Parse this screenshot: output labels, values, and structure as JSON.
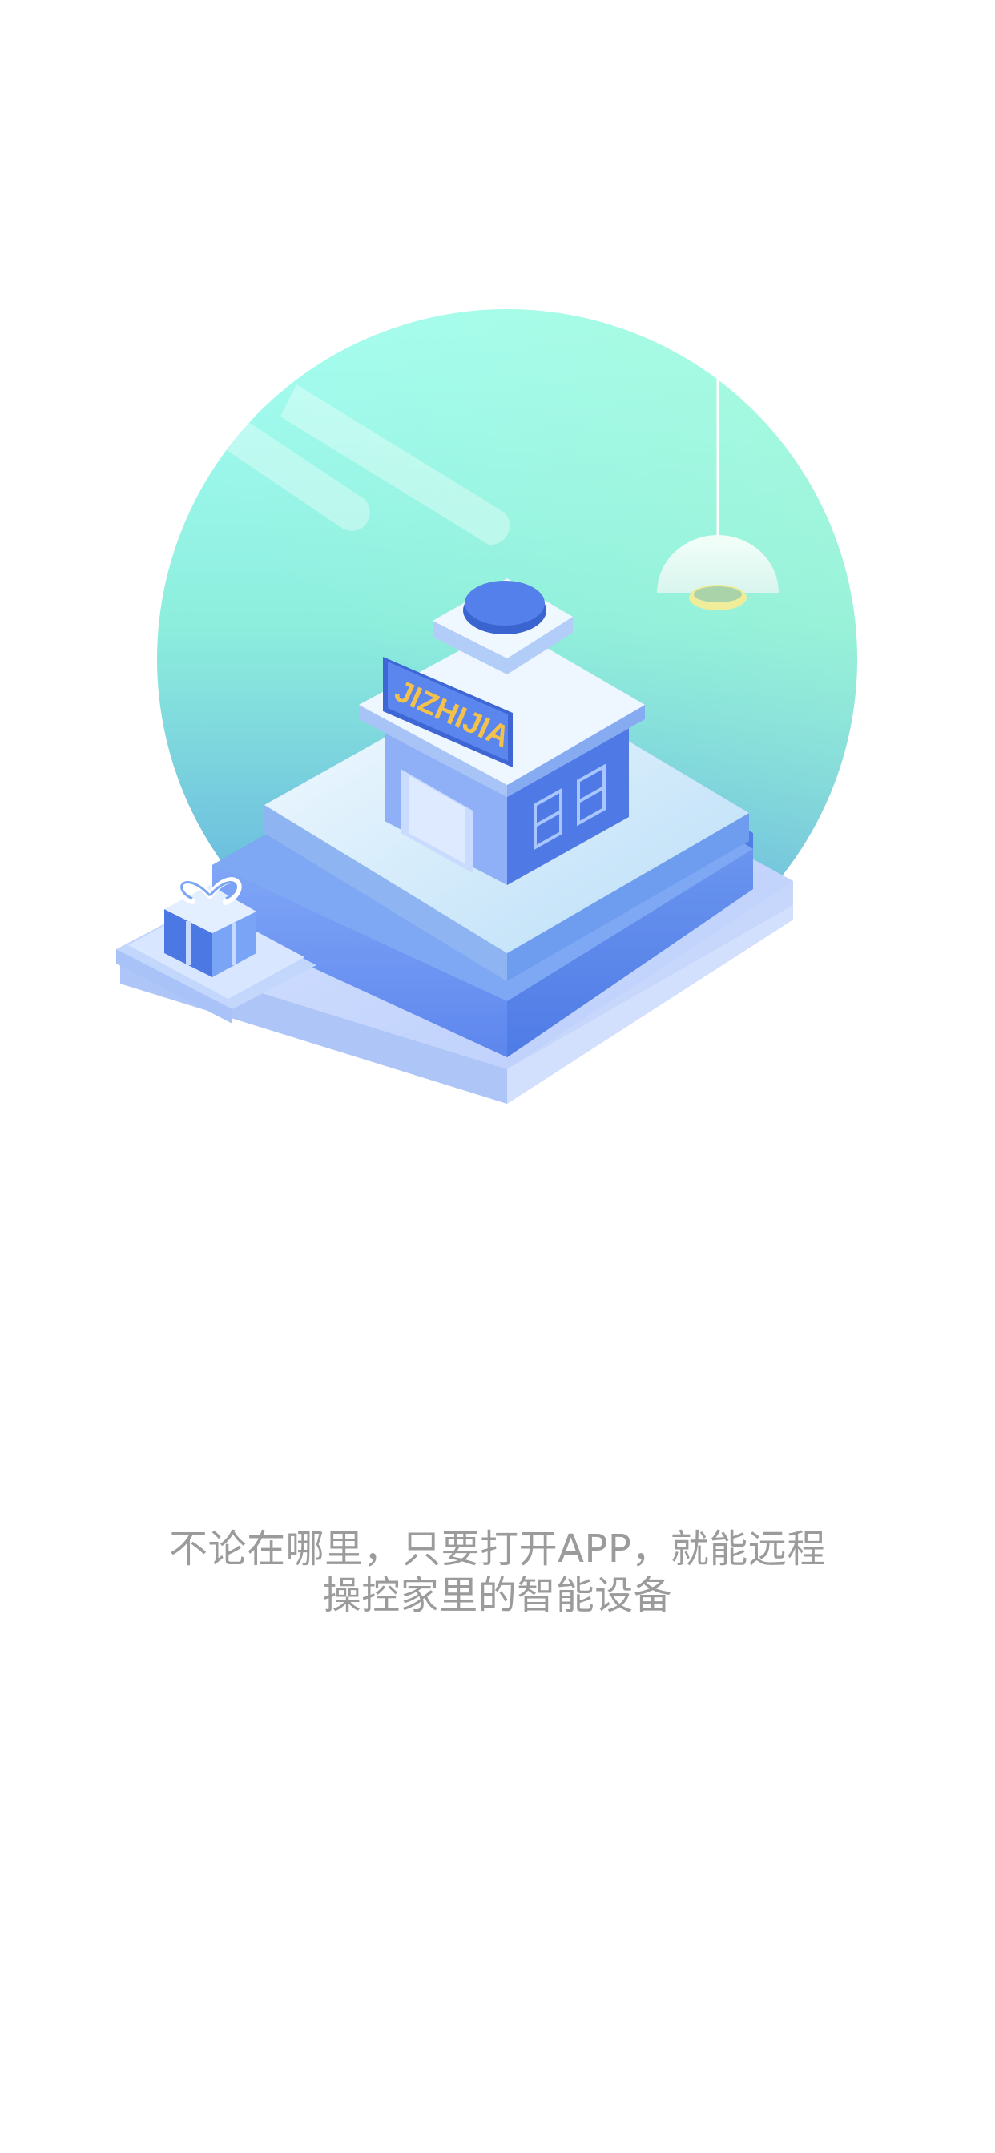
{
  "hero": {
    "sign_text": "JIZHIJIA"
  },
  "caption": {
    "line1": "不论在哪里，只要打开APP，就能远程",
    "line2": "操控家里的智能设备"
  },
  "colors": {
    "circle_top": "#a4fcf6",
    "circle_bottom": "#5ba8dd",
    "building_blue": "#5a86ee",
    "sign_text": "#f4c24a",
    "caption_text": "#9b9b9b",
    "background": "#ffffff"
  }
}
